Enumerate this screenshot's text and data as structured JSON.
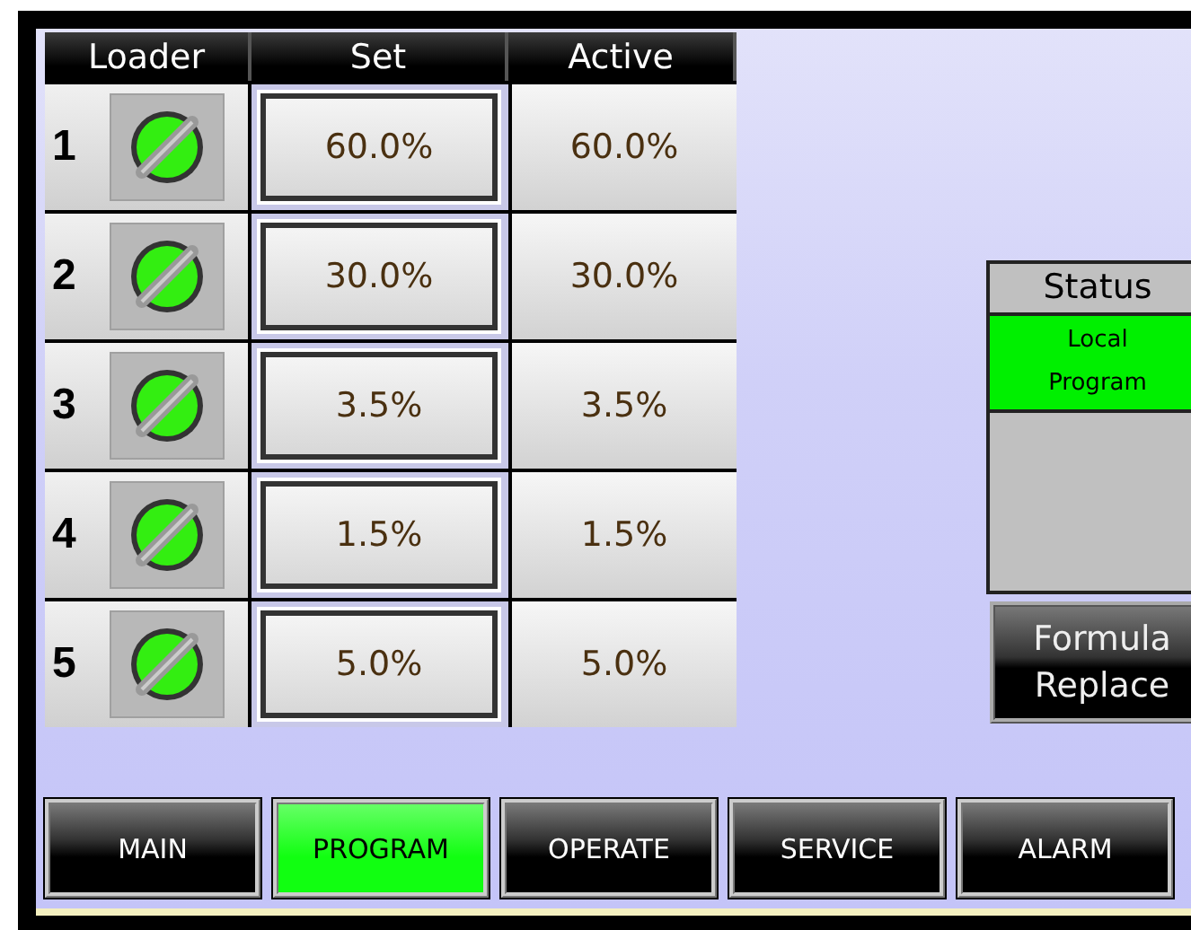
{
  "table": {
    "columns": [
      "Loader",
      "Set",
      "Active"
    ],
    "rows": [
      {
        "loader": "1",
        "set": "60.0%",
        "active": "60.0%"
      },
      {
        "loader": "2",
        "set": "30.0%",
        "active": "30.0%"
      },
      {
        "loader": "3",
        "set": "3.5%",
        "active": "3.5%"
      },
      {
        "loader": "4",
        "set": "1.5%",
        "active": "1.5%"
      },
      {
        "loader": "5",
        "set": "5.0%",
        "active": "5.0%"
      }
    ]
  },
  "status": {
    "title": "Status",
    "lines": [
      "Local",
      "Program"
    ]
  },
  "formula_button": [
    "Formula",
    "Replace"
  ],
  "nav": [
    {
      "label": "MAIN",
      "selected": false
    },
    {
      "label": "PROGRAM",
      "selected": true
    },
    {
      "label": "OPERATE",
      "selected": false
    },
    {
      "label": "SERVICE",
      "selected": false
    },
    {
      "label": "ALARM",
      "selected": false
    }
  ]
}
